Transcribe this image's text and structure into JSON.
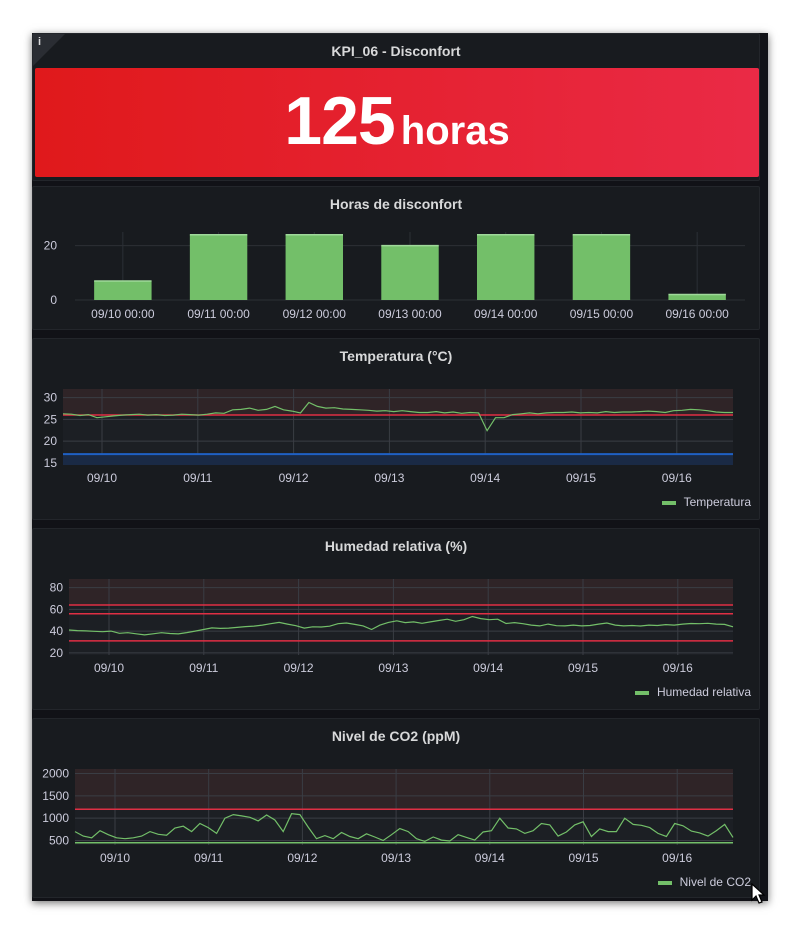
{
  "stat": {
    "title": "KPI_06 - Disconfort",
    "value": "125",
    "unit": "horas",
    "info_icon": "info-icon"
  },
  "colors": {
    "bg": "#111217",
    "panel": "#181b1f",
    "green": "#73bf69",
    "red": "#e02f44",
    "blue": "#1f60c4",
    "stat_from": "#e0191b",
    "stat_to": "#ea2a46"
  },
  "chart_data": [
    {
      "type": "bar",
      "title": "Horas de disconfort",
      "categories": [
        "09/10 00:00",
        "09/11 00:00",
        "09/12 00:00",
        "09/13 00:00",
        "09/14 00:00",
        "09/15 00:00",
        "09/16 00:00"
      ],
      "values": [
        7,
        24,
        24,
        20,
        24,
        24,
        2
      ],
      "yticks": [
        0,
        20
      ],
      "ylim": [
        0,
        25
      ]
    },
    {
      "type": "line",
      "title": "Temperatura (°C)",
      "xticks": [
        "09/10",
        "09/11",
        "09/12",
        "09/13",
        "09/14",
        "09/15",
        "09/16"
      ],
      "yticks": [
        15,
        20,
        25,
        30
      ],
      "ylim": [
        14.5,
        32
      ],
      "thresholds": [
        {
          "value": 26,
          "color": "red"
        },
        {
          "value": 17,
          "color": "blue"
        }
      ],
      "series": [
        {
          "name": "Temperatura",
          "values": [
            26.3,
            26.2,
            25.9,
            26.1,
            25.4,
            25.6,
            25.8,
            26,
            26.1,
            26.2,
            26,
            26.1,
            25.9,
            26,
            26.2,
            26.1,
            26,
            26.2,
            26.5,
            26.4,
            27.2,
            27.3,
            27.6,
            27.1,
            27.3,
            28,
            27.2,
            26.9,
            26.5,
            28.9,
            28,
            27.6,
            27.7,
            27.4,
            27.3,
            27.2,
            27.1,
            26.9,
            27,
            26.8,
            27,
            26.8,
            26.6,
            26.6,
            26.8,
            26.5,
            26.7,
            26.4,
            26.6,
            26.5,
            22.4,
            25.4,
            25.4,
            26.1,
            26.3,
            26.5,
            26.3,
            26.5,
            26.6,
            26.6,
            26.7,
            26.5,
            26.6,
            26.5,
            26.8,
            26.6,
            26.7,
            26.7,
            26.8,
            26.9,
            26.8,
            26.6,
            27,
            27.1,
            27.3,
            27.2,
            27,
            26.7,
            26.6,
            26.6
          ]
        }
      ]
    },
    {
      "type": "line",
      "title": "Humedad relativa (%)",
      "xticks": [
        "09/10",
        "09/11",
        "09/12",
        "09/13",
        "09/14",
        "09/15",
        "09/16"
      ],
      "yticks": [
        20,
        40,
        60,
        80
      ],
      "ylim": [
        18,
        88
      ],
      "thresholds": [
        {
          "value": 64,
          "color": "red"
        },
        {
          "value": 56,
          "color": "red"
        },
        {
          "value": 31,
          "color": "red"
        }
      ],
      "series": [
        {
          "name": "Humedad relativa",
          "values": [
            41,
            40.5,
            40.2,
            39.8,
            39.5,
            40,
            38,
            38.5,
            37.5,
            36.5,
            37.5,
            38.5,
            37.8,
            37.4,
            38.6,
            40,
            41.5,
            43,
            42.5,
            42.8,
            43.4,
            44.2,
            44.6,
            45.5,
            46.8,
            48,
            46.5,
            45,
            42.8,
            44,
            43.8,
            44.5,
            46.8,
            47.5,
            46.2,
            44.8,
            41.5,
            45.5,
            48,
            49.5,
            47.8,
            48.5,
            47.2,
            48.5,
            49.8,
            51,
            49,
            50.5,
            53.5,
            51.5,
            50.5,
            51,
            47,
            47.8,
            46.8,
            45.5,
            44.8,
            46.5,
            45,
            44.8,
            45.5,
            44.8,
            45.2,
            46.5,
            47.5,
            45.5,
            44.8,
            45.2,
            44.7,
            45.5,
            45.2,
            46,
            45.5,
            46.5,
            47,
            46.8,
            47.2,
            46.5,
            46.2,
            44
          ]
        }
      ]
    },
    {
      "type": "line",
      "title": "Nivel de CO2 (ppM)",
      "xticks": [
        "09/10",
        "09/11",
        "09/12",
        "09/13",
        "09/14",
        "09/15",
        "09/16"
      ],
      "yticks": [
        500,
        1000,
        1500,
        2000
      ],
      "ylim": [
        400,
        2100
      ],
      "thresholds": [
        {
          "value": 1200,
          "color": "red"
        },
        {
          "value": 450,
          "color": "green"
        }
      ],
      "series": [
        {
          "name": "Nivel de CO2",
          "values": [
            700,
            600,
            560,
            720,
            630,
            560,
            540,
            560,
            600,
            700,
            640,
            620,
            780,
            820,
            700,
            880,
            790,
            660,
            1000,
            1080,
            1050,
            1020,
            940,
            1070,
            960,
            700,
            1100,
            1080,
            800,
            540,
            610,
            540,
            680,
            590,
            540,
            650,
            580,
            500,
            630,
            770,
            700,
            540,
            480,
            580,
            510,
            490,
            630,
            570,
            510,
            690,
            720,
            1000,
            780,
            760,
            660,
            720,
            880,
            850,
            600,
            690,
            850,
            920,
            590,
            760,
            700,
            700,
            1000,
            860,
            840,
            790,
            660,
            590,
            880,
            830,
            710,
            670,
            600,
            720,
            860,
            570
          ]
        }
      ]
    }
  ]
}
